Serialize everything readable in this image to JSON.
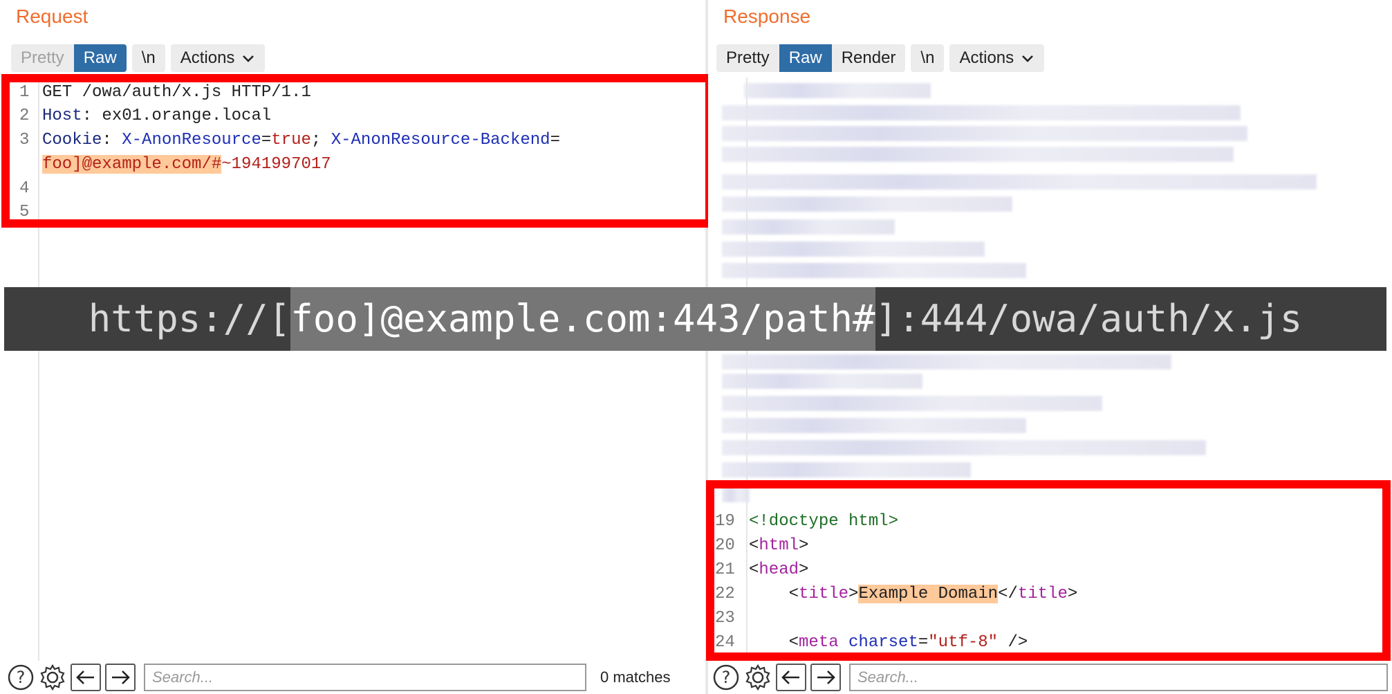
{
  "request": {
    "title": "Request",
    "tabs": [
      "Pretty",
      "Raw",
      "\\n"
    ],
    "actions_label": "Actions",
    "line_numbers": [
      "1",
      "2",
      "3",
      "",
      "4",
      "5"
    ],
    "lines": {
      "l1": "GET /owa/auth/x.js HTTP/1.1",
      "l2_key": "Host",
      "l2_rest": ": ex01.orange.local",
      "l3_key": "Cookie",
      "l3_colon": ": ",
      "l3_name1": "X-AnonResource",
      "l3_eq1": "=",
      "l3_val1": "true",
      "l3_sep": "; ",
      "l3_name2": "X-AnonResource-Backend",
      "l3_eq2": "=",
      "l3_val2_hl": "foo]@example.com/#",
      "l3_val2_rest": "~1941997017"
    },
    "search_placeholder": "Search...",
    "matches": "0 matches"
  },
  "response": {
    "title": "Response",
    "tabs": [
      "Pretty",
      "Raw",
      "Render",
      "\\n"
    ],
    "actions_label": "Actions",
    "line_numbers": [
      "19",
      "20",
      "21",
      "22",
      "23",
      "24"
    ],
    "lines": {
      "l19": "<!doctype html>",
      "l20_open": "<",
      "l20_tag": "html",
      "l20_close": ">",
      "l21_open": "<",
      "l21_tag": "head",
      "l21_close": ">",
      "l22_indent": "    ",
      "l22_open": "<",
      "l22_tag": "title",
      "l22_close": ">",
      "l22_text": "Example Domain",
      "l22_end_open": "</",
      "l22_end_tag": "title",
      "l22_end_close": ">",
      "l24_indent": "    ",
      "l24_open": "<",
      "l24_tag": "meta",
      "l24_sp": " ",
      "l24_attr": "charset",
      "l24_eq": "=",
      "l24_val": "\"utf-8\"",
      "l24_end": " />"
    },
    "search_placeholder": "Search..."
  },
  "banner": {
    "prefix": "https://[",
    "highlight": "foo]@example.com:443/path#",
    "suffix": "]:444/owa/auth/x.js"
  },
  "colors": {
    "title_orange": "#ef6d2e",
    "active_tab": "#2f6da6",
    "annotation_red": "#ff0000",
    "highlight_orange": "#ffc99a"
  },
  "icons": [
    "help-icon",
    "settings-gear-icon",
    "arrow-left-icon",
    "arrow-right-icon",
    "chevron-down-icon"
  ]
}
